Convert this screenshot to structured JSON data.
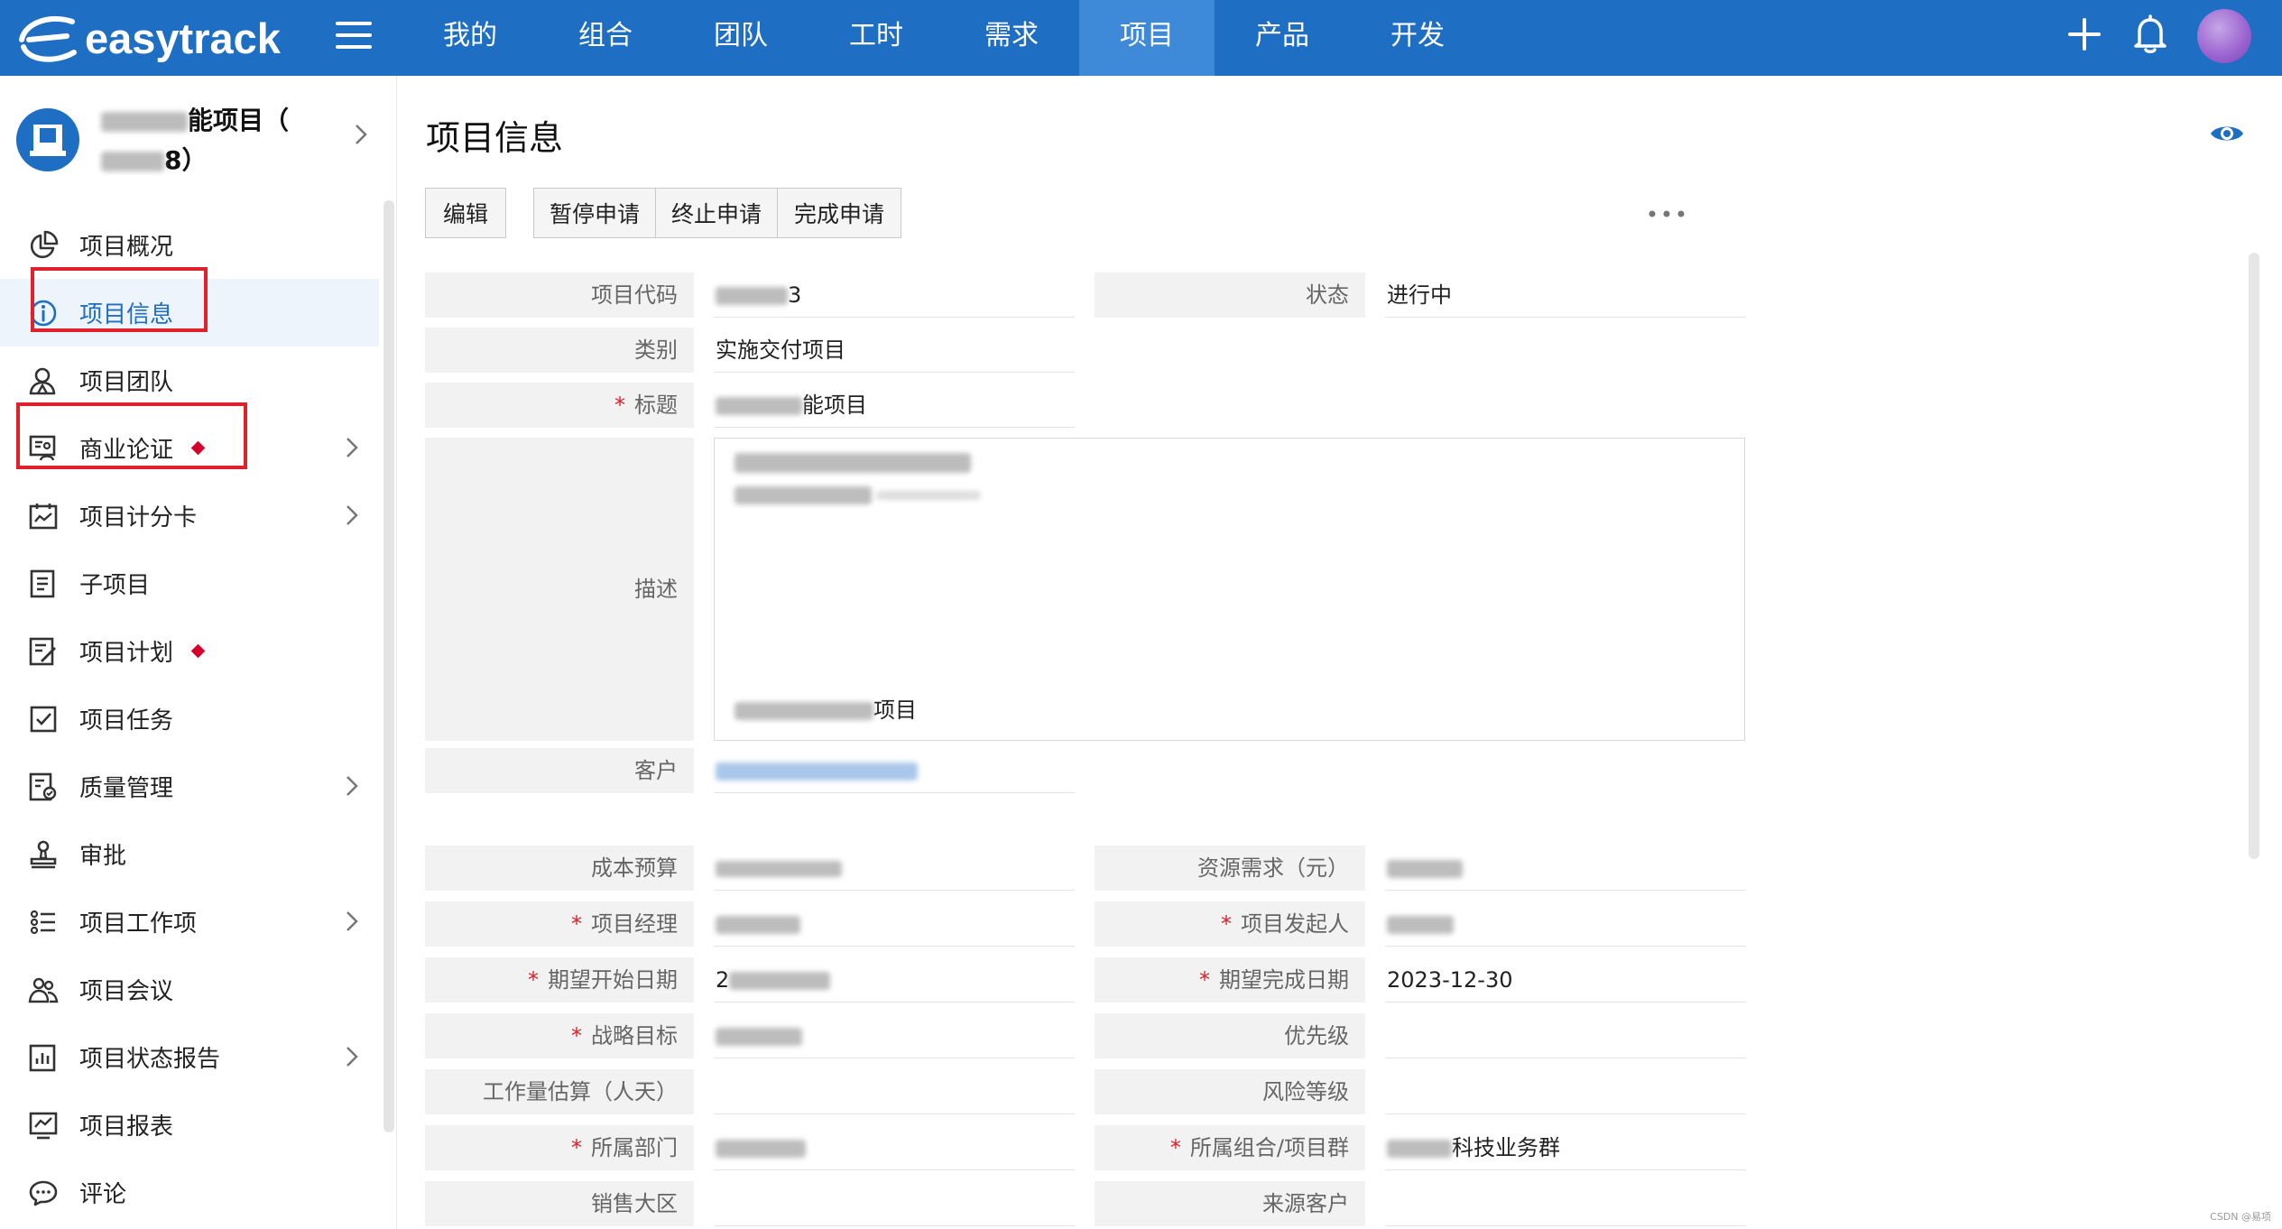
{
  "topbar": {
    "brand": "easytrack",
    "nav": [
      {
        "label": "我的",
        "active": false
      },
      {
        "label": "组合",
        "active": false
      },
      {
        "label": "团队",
        "active": false
      },
      {
        "label": "工时",
        "active": false
      },
      {
        "label": "需求",
        "active": false
      },
      {
        "label": "项目",
        "active": true
      },
      {
        "label": "产品",
        "active": false
      },
      {
        "label": "开发",
        "active": false
      }
    ],
    "icons": [
      "menu-icon",
      "plus-icon",
      "bell-icon",
      "user-avatar"
    ],
    "color": "#1e6ec4"
  },
  "sidebar": {
    "project_name_line1": "能项目（",
    "project_name_line2": "8）",
    "items": [
      {
        "label": "项目概况",
        "icon": "pie-chart-icon",
        "chevron": false,
        "dot": false,
        "active": false
      },
      {
        "label": "项目信息",
        "icon": "info-icon",
        "chevron": false,
        "dot": false,
        "active": true
      },
      {
        "label": "项目团队",
        "icon": "team-icon",
        "chevron": false,
        "dot": false,
        "active": false
      },
      {
        "label": "商业论证",
        "icon": "business-case-icon",
        "chevron": true,
        "dot": true,
        "active": false
      },
      {
        "label": "项目计分卡",
        "icon": "scorecard-icon",
        "chevron": true,
        "dot": false,
        "active": false
      },
      {
        "label": "子项目",
        "icon": "subproject-icon",
        "chevron": false,
        "dot": false,
        "active": false
      },
      {
        "label": "项目计划",
        "icon": "plan-icon",
        "chevron": false,
        "dot": true,
        "active": false
      },
      {
        "label": "项目任务",
        "icon": "task-icon",
        "chevron": false,
        "dot": false,
        "active": false
      },
      {
        "label": "质量管理",
        "icon": "quality-icon",
        "chevron": true,
        "dot": false,
        "active": false
      },
      {
        "label": "审批",
        "icon": "stamp-icon",
        "chevron": false,
        "dot": false,
        "active": false
      },
      {
        "label": "项目工作项",
        "icon": "list-icon",
        "chevron": true,
        "dot": false,
        "active": false
      },
      {
        "label": "项目会议",
        "icon": "meeting-icon",
        "chevron": false,
        "dot": false,
        "active": false
      },
      {
        "label": "项目状态报告",
        "icon": "status-report-icon",
        "chevron": true,
        "dot": false,
        "active": false
      },
      {
        "label": "项目报表",
        "icon": "report-chart-icon",
        "chevron": false,
        "dot": false,
        "active": false
      },
      {
        "label": "评论",
        "icon": "comment-icon",
        "chevron": false,
        "dot": false,
        "active": false
      }
    ]
  },
  "main": {
    "title": "项目信息",
    "buttons": {
      "edit": "编辑",
      "pause": "暂停申请",
      "terminate": "终止申请",
      "complete": "完成申请"
    },
    "fields": {
      "code": {
        "label": "项目代码",
        "value": "3",
        "required": false
      },
      "status": {
        "label": "状态",
        "value": "进行中",
        "required": false
      },
      "category": {
        "label": "类别",
        "value": "实施交付项目",
        "required": false
      },
      "title": {
        "label": "标题",
        "value": "能项目",
        "required": true
      },
      "description": {
        "label": "描述",
        "value_tail": "项目",
        "required": false
      },
      "customer": {
        "label": "客户",
        "required": false
      },
      "cost_budget": {
        "label": "成本预算",
        "required": false
      },
      "resource_demand": {
        "label": "资源需求（元）",
        "required": false
      },
      "pm": {
        "label": "项目经理",
        "required": true
      },
      "sponsor": {
        "label": "项目发起人",
        "required": true
      },
      "start_date": {
        "label": "期望开始日期",
        "value": "2",
        "required": true
      },
      "end_date": {
        "label": "期望完成日期",
        "value": "2023-12-30",
        "required": true
      },
      "strategy": {
        "label": "战略目标",
        "required": true
      },
      "priority": {
        "label": "优先级",
        "value": "",
        "required": false
      },
      "effort": {
        "label": "工作量估算（人天）",
        "value": "",
        "required": false
      },
      "risk": {
        "label": "风险等级",
        "value": "",
        "required": false
      },
      "dept": {
        "label": "所属部门",
        "required": true
      },
      "portfolio": {
        "label": "所属组合/项目群",
        "value": "科技业务群",
        "required": true
      },
      "sales_region": {
        "label": "销售大区",
        "value": "",
        "required": false
      },
      "source_customer": {
        "label": "来源客户",
        "value": "",
        "required": false
      }
    }
  },
  "watermark": "CSDN @易项"
}
